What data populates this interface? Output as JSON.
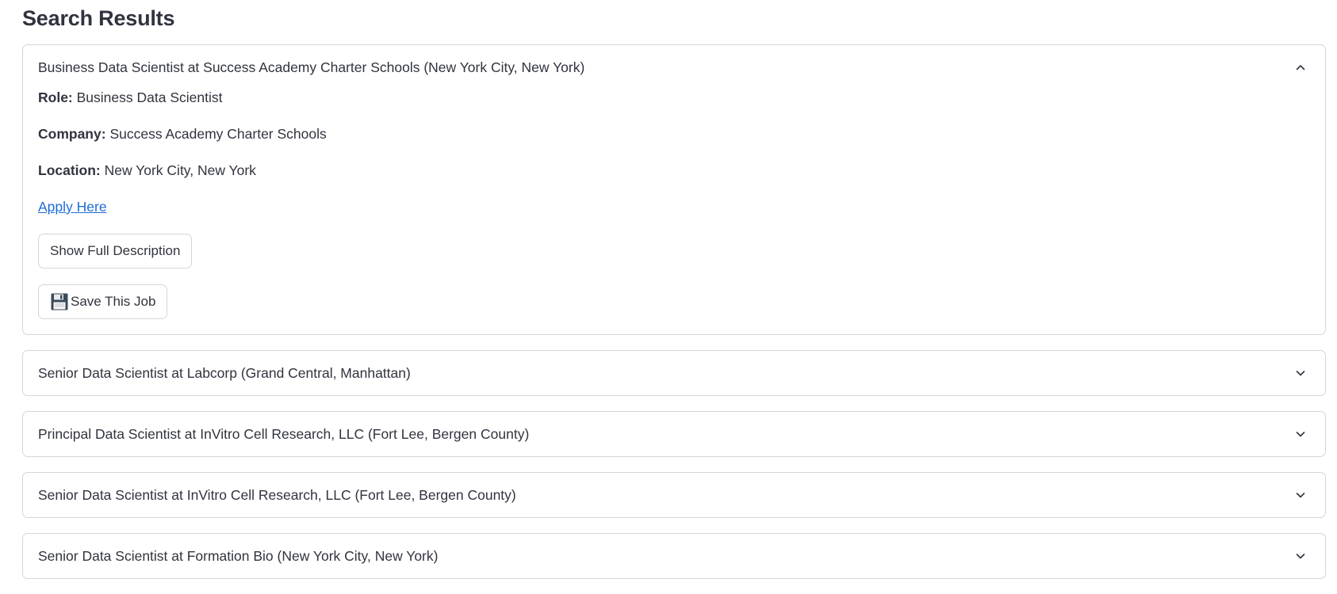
{
  "page": {
    "title": "Search Results"
  },
  "labels": {
    "role": "Role:",
    "company": "Company:",
    "location": "Location:"
  },
  "results": [
    {
      "header": "Business Data Scientist at Success Academy Charter Schools (New York City, New York)",
      "expanded": true,
      "role": "Business Data Scientist",
      "company": "Success Academy Charter Schools",
      "location": "New York City, New York",
      "apply_label": "Apply Here",
      "show_description_label": "Show Full Description",
      "save_label": "Save This Job"
    },
    {
      "header": "Senior Data Scientist at Labcorp (Grand Central, Manhattan)",
      "expanded": false
    },
    {
      "header": "Principal Data Scientist at InVitro Cell Research, LLC (Fort Lee, Bergen County)",
      "expanded": false
    },
    {
      "header": "Senior Data Scientist at InVitro Cell Research, LLC (Fort Lee, Bergen County)",
      "expanded": false
    },
    {
      "header": "Senior Data Scientist at Formation Bio (New York City, New York)",
      "expanded": false
    }
  ],
  "icons": {
    "expanded": "chevron-up-icon",
    "collapsed": "chevron-down-icon",
    "save": "floppy-disk-icon"
  },
  "colors": {
    "link": "#1c6cd6",
    "text": "#31333f",
    "border": "#d6d6d9"
  }
}
